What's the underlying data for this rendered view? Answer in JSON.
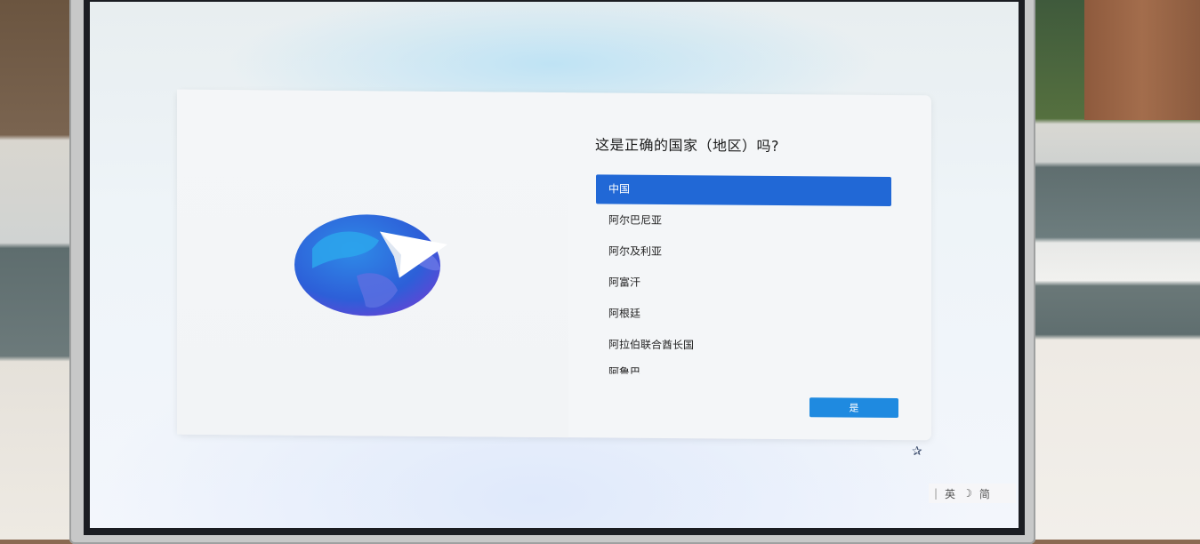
{
  "oobe": {
    "title": "这是正确的国家（地区）吗?",
    "countries": [
      {
        "label": "中国",
        "selected": true
      },
      {
        "label": "阿尔巴尼亚",
        "selected": false
      },
      {
        "label": "阿尔及利亚",
        "selected": false
      },
      {
        "label": "阿富汗",
        "selected": false
      },
      {
        "label": "阿根廷",
        "selected": false
      },
      {
        "label": "阿拉伯联合酋长国",
        "selected": false
      },
      {
        "label": "阿鲁巴",
        "selected": false
      }
    ],
    "yes_label": "是",
    "illustration": "globe-with-paper-plane"
  },
  "tray": {
    "ime_mode": "英",
    "ime_moon": "☽",
    "ime_script": "简",
    "accessibility_icon": "accessibility-icon"
  },
  "colors": {
    "accent": "#2168d6",
    "button": "#1f8ae0"
  }
}
